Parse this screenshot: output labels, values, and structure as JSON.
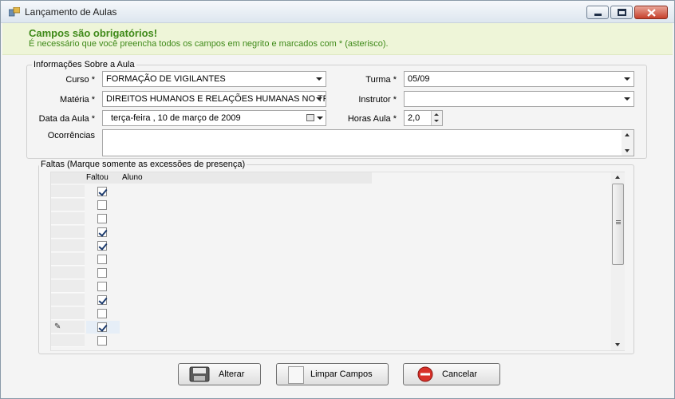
{
  "window": {
    "title": "Lançamento de Aulas",
    "icon": "app-window-icon"
  },
  "banner": {
    "title": "Campos são obrigatórios!",
    "subtitle": "É necessário que você preencha todos os campos em negrito e marcados com * (asterisco).",
    "color": "#3f8a19"
  },
  "info_group": {
    "title": "Informações Sobre a Aula",
    "curso_label": "Curso *",
    "curso_value": "FORMAÇÃO DE VIGILANTES",
    "turma_label": "Turma *",
    "turma_value": "05/09",
    "materia_label": "Matéria *",
    "materia_value": "DIREITOS HUMANOS E RELAÇÕES HUMANAS NO TR",
    "instrutor_label": "Instrutor *",
    "instrutor_value": "",
    "data_label": "Data da Aula *",
    "data_value": "terça-feira  , 10 de    março    de 2009",
    "horas_label": "Horas Aula *",
    "horas_value": "2,0",
    "ocorrencias_label": "Ocorrências",
    "ocorrencias_value": ""
  },
  "faltas_group": {
    "title": "Faltas (Marque somente as excessões de presença)",
    "columns": [
      "Faltou",
      "Aluno"
    ],
    "rows": [
      {
        "faltou": true
      },
      {
        "faltou": false
      },
      {
        "faltou": false
      },
      {
        "faltou": true
      },
      {
        "faltou": true
      },
      {
        "faltou": false
      },
      {
        "faltou": false
      },
      {
        "faltou": false
      },
      {
        "faltou": true
      },
      {
        "faltou": false
      },
      {
        "faltou": true,
        "editing": true
      },
      {
        "faltou": false
      }
    ]
  },
  "buttons": {
    "alterar": "Alterar",
    "limpar": "Limpar Campos",
    "cancelar": "Cancelar"
  }
}
